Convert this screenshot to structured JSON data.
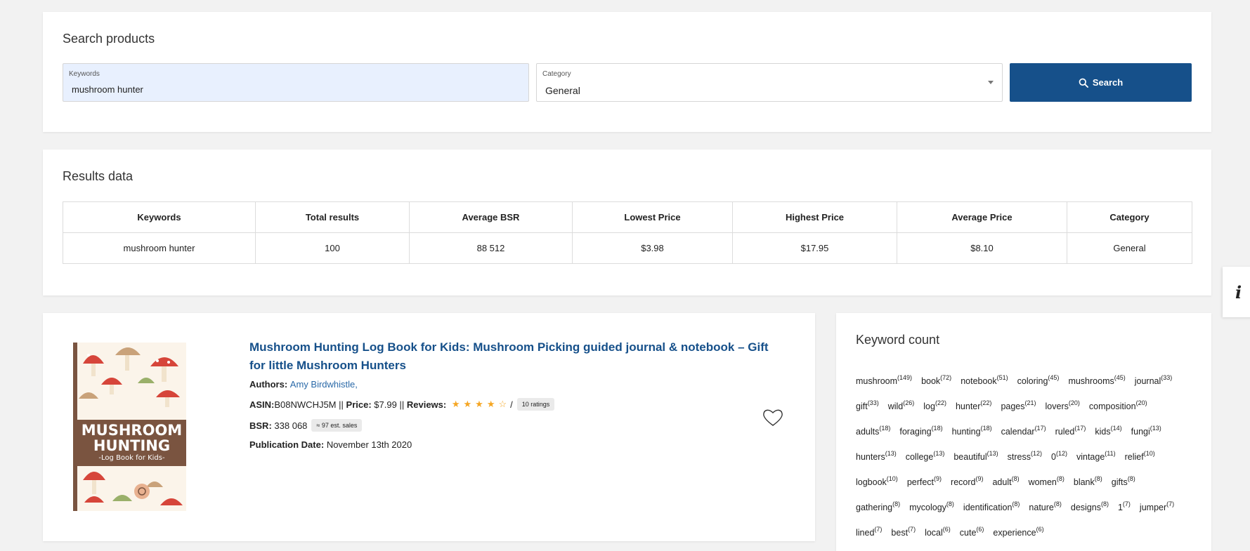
{
  "search": {
    "title": "Search products",
    "keywords_label": "Keywords",
    "keywords_value": "mushroom hunter",
    "category_label": "Category",
    "category_value": "General",
    "button_label": "Search"
  },
  "results": {
    "title": "Results data",
    "columns": [
      "Keywords",
      "Total results",
      "Average BSR",
      "Lowest Price",
      "Highest Price",
      "Average Price",
      "Category"
    ],
    "row": [
      "mushroom hunter",
      "100",
      "88 512",
      "$3.98",
      "$17.95",
      "$8.10",
      "General"
    ]
  },
  "product": {
    "cover": {
      "title_line1": "MUSHROOM",
      "title_line2": "HUNTING",
      "subtitle": "-Log Book for Kids-"
    },
    "title": "Mushroom Hunting Log Book for Kids: Mushroom Picking guided journal & notebook – Gift for little Mushroom Hunters",
    "authors_label": "Authors:",
    "authors_value": "Amy Birdwhistle,",
    "asin_label": "ASIN:",
    "asin_value": "B08NWCHJ5M",
    "separator": "||",
    "price_label": "Price:",
    "price_value": "$7.99",
    "reviews_label": "Reviews:",
    "rating": 4,
    "rating_max": 5,
    "ratings_sep": "/",
    "ratings_count": "10 ratings",
    "bsr_label": "BSR:",
    "bsr_value": "338 068",
    "est_sales": "≈ 97 est. sales",
    "pubdate_label": "Publication Date:",
    "pubdate_value": "November 13th 2020"
  },
  "keyword_count": {
    "title": "Keyword count",
    "items": [
      {
        "word": "mushroom",
        "count": "149"
      },
      {
        "word": "book",
        "count": "72"
      },
      {
        "word": "notebook",
        "count": "51"
      },
      {
        "word": "coloring",
        "count": "45"
      },
      {
        "word": "mushrooms",
        "count": "45"
      },
      {
        "word": "journal",
        "count": "33"
      },
      {
        "word": "gift",
        "count": "33"
      },
      {
        "word": "wild",
        "count": "26"
      },
      {
        "word": "log",
        "count": "22"
      },
      {
        "word": "hunter",
        "count": "22"
      },
      {
        "word": "pages",
        "count": "21"
      },
      {
        "word": "lovers",
        "count": "20"
      },
      {
        "word": "composition",
        "count": "20"
      },
      {
        "word": "adults",
        "count": "18"
      },
      {
        "word": "foraging",
        "count": "18"
      },
      {
        "word": "hunting",
        "count": "18"
      },
      {
        "word": "calendar",
        "count": "17"
      },
      {
        "word": "ruled",
        "count": "17"
      },
      {
        "word": "kids",
        "count": "14"
      },
      {
        "word": "fungi",
        "count": "13"
      },
      {
        "word": "hunters",
        "count": "13"
      },
      {
        "word": "college",
        "count": "13"
      },
      {
        "word": "beautiful",
        "count": "13"
      },
      {
        "word": "stress",
        "count": "12"
      },
      {
        "word": "0",
        "count": "12"
      },
      {
        "word": "vintage",
        "count": "11"
      },
      {
        "word": "relief",
        "count": "10"
      },
      {
        "word": "logbook",
        "count": "10"
      },
      {
        "word": "perfect",
        "count": "9"
      },
      {
        "word": "record",
        "count": "9"
      },
      {
        "word": "adult",
        "count": "8"
      },
      {
        "word": "women",
        "count": "8"
      },
      {
        "word": "blank",
        "count": "8"
      },
      {
        "word": "gifts",
        "count": "8"
      },
      {
        "word": "gathering",
        "count": "8"
      },
      {
        "word": "mycology",
        "count": "8"
      },
      {
        "word": "identification",
        "count": "8"
      },
      {
        "word": "nature",
        "count": "8"
      },
      {
        "word": "designs",
        "count": "8"
      },
      {
        "word": "1",
        "count": "7"
      },
      {
        "word": "jumper",
        "count": "7"
      },
      {
        "word": "lined",
        "count": "7"
      },
      {
        "word": "best",
        "count": "7"
      },
      {
        "word": "local",
        "count": "6"
      },
      {
        "word": "cute",
        "count": "6"
      },
      {
        "word": "experience",
        "count": "6"
      }
    ]
  },
  "info_label": "i",
  "icons": {
    "search": "search-icon",
    "dropdown": "chevron-down-icon",
    "favorite": "heart-icon",
    "info": "info-icon"
  },
  "colors": {
    "primary": "#16508a",
    "link": "#2a69a8",
    "star": "#f5a623",
    "keywords_field_bg": "#e8f0fe",
    "cover_band": "#7a5440"
  }
}
